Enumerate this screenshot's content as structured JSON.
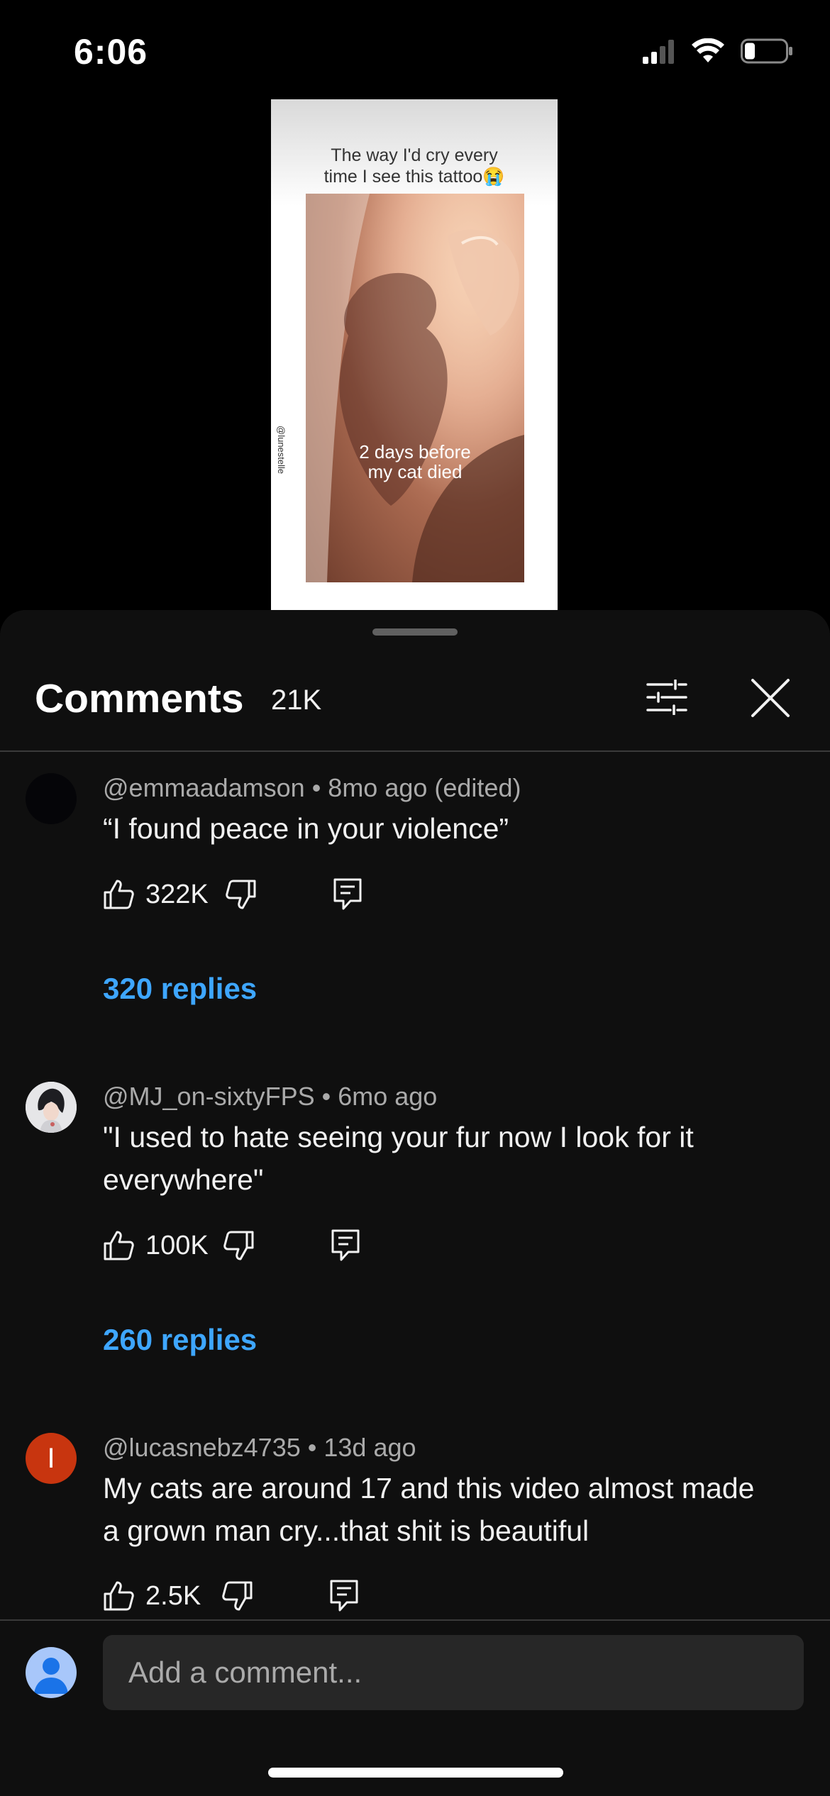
{
  "status_bar": {
    "time": "6:06",
    "icons": [
      "cellular-signal-icon",
      "wifi-icon",
      "battery-icon"
    ]
  },
  "video": {
    "caption_line1": "The way I'd cry every",
    "caption_line2": "time I see this tattoo😭",
    "overlay_line1": "2 days before",
    "overlay_line2": "my cat died",
    "watermark": "@lunestelle"
  },
  "comments_panel": {
    "title": "Comments",
    "count": "21K",
    "comments": [
      {
        "author": "@emmaadamson",
        "time": "8mo ago (edited)",
        "text": "“I found peace in your violence”",
        "likes": "322K",
        "replies": "320 replies"
      },
      {
        "author": "@MJ_on-sixtyFPS",
        "time": "6mo ago",
        "text": "\"I used to hate seeing your fur now I look for it everywhere\"",
        "likes": "100K",
        "replies": "260 replies"
      },
      {
        "author": "@lucasnebz4735",
        "avatar_letter": "I",
        "time": "13d ago",
        "text": "My cats are around 17 and this video almost made a grown man cry...that shit is beautiful",
        "likes": "2.5K"
      }
    ]
  },
  "composer": {
    "placeholder": "Add a comment..."
  },
  "colors": {
    "background": "#0f0f0f",
    "link": "#3ea6ff",
    "meta": "#aaaaaa",
    "avatar3": "#c8350f",
    "user_avatar": "#a8c7fa"
  }
}
